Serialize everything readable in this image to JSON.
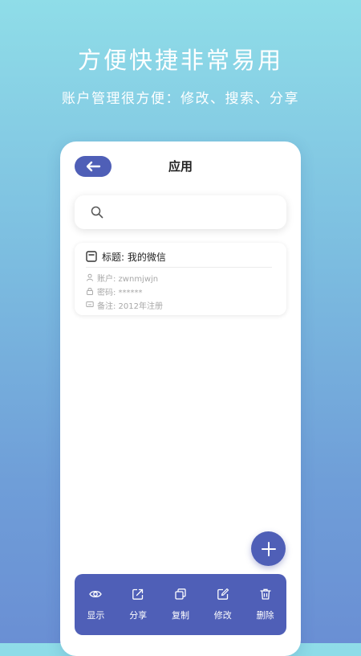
{
  "promo": {
    "headline": "方便快捷非常易用",
    "subline": "账户管理很方便：修改、搜索、分享"
  },
  "screen": {
    "title": "应用"
  },
  "search": {
    "value": "",
    "placeholder": ""
  },
  "entries": [
    {
      "title": "标题: 我的微信",
      "account": "账户: zwnmjwjn",
      "password": "密码: ******",
      "note": "备注: 2012年注册"
    }
  ],
  "toolbar": {
    "items": [
      {
        "label": "显示",
        "icon": "eye-icon"
      },
      {
        "label": "分享",
        "icon": "share-icon"
      },
      {
        "label": "复制",
        "icon": "copy-icon"
      },
      {
        "label": "修改",
        "icon": "edit-icon"
      },
      {
        "label": "删除",
        "icon": "trash-icon"
      }
    ]
  },
  "colors": {
    "accent": "#4f5fb7",
    "background_top": "#8fdde8",
    "background_bottom": "#6a8fd4"
  }
}
